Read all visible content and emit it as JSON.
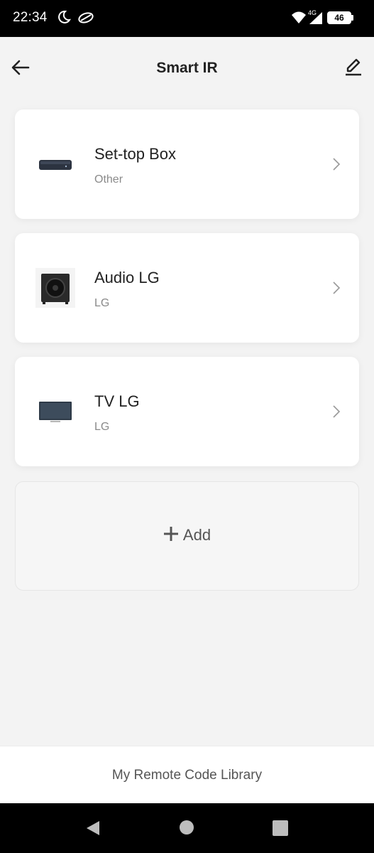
{
  "status_bar": {
    "time": "22:34",
    "network": "4G",
    "battery": "46"
  },
  "header": {
    "title": "Smart IR",
    "back_icon": "arrow-left-icon",
    "edit_icon": "pencil-icon"
  },
  "devices": [
    {
      "name": "Set-top Box",
      "brand": "Other",
      "icon": "set-top-box-icon"
    },
    {
      "name": "Audio LG",
      "brand": "LG",
      "icon": "speaker-icon"
    },
    {
      "name": "TV LG",
      "brand": "LG",
      "icon": "tv-icon"
    }
  ],
  "add_button": {
    "label": "Add",
    "icon": "plus-icon"
  },
  "footer": {
    "library_label": "My Remote Code Library"
  },
  "colors": {
    "background": "#f3f3f3",
    "card": "#ffffff",
    "title_text": "#222222",
    "secondary_text": "#8a8a8a"
  }
}
